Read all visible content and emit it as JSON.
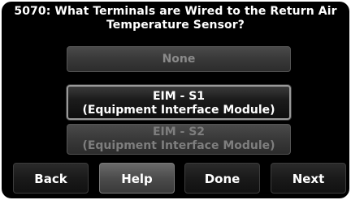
{
  "header": {
    "title_line1": "5070: What Terminals are Wired to the Return Air",
    "title_line2": "Temperature Sensor?"
  },
  "options": [
    {
      "line1": "None",
      "line2": "",
      "state": "disabled"
    },
    {
      "line1": "EIM - S1",
      "line2": "(Equipment Interface Module)",
      "state": "selected"
    },
    {
      "line1": "EIM - S2",
      "line2": "(Equipment Interface Module)",
      "state": "disabled"
    }
  ],
  "footer": {
    "back_label": "Back",
    "help_label": "Help",
    "done_label": "Done",
    "next_label": "Next"
  },
  "colors": {
    "background": "#000000",
    "text": "#ffffff",
    "disabled_text": "#8a8a8a",
    "selected_border": "#9a9a9a"
  }
}
